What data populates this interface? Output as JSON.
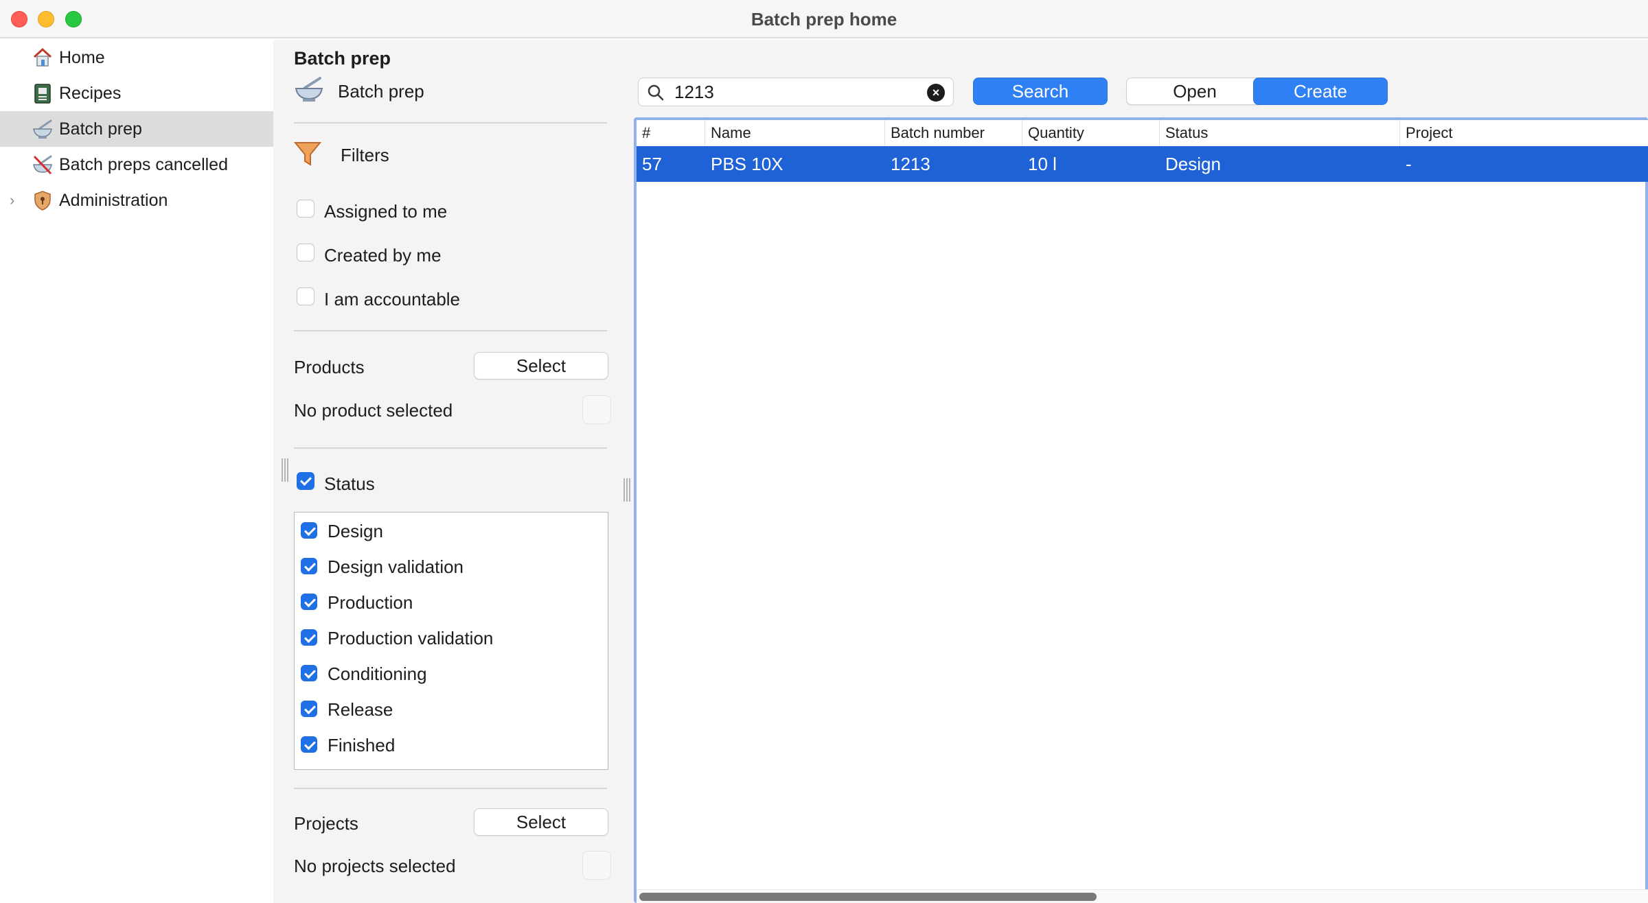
{
  "window": {
    "title": "Batch prep home"
  },
  "sidebar": {
    "items": [
      {
        "label": "Home",
        "icon": "home-icon"
      },
      {
        "label": "Recipes",
        "icon": "recipe-book-icon"
      },
      {
        "label": "Batch prep",
        "icon": "mortar-icon",
        "selected": true
      },
      {
        "label": "Batch preps cancelled",
        "icon": "cancelled-mortar-icon"
      },
      {
        "label": "Administration",
        "icon": "shield-icon",
        "expandable": true
      }
    ]
  },
  "filters": {
    "heading": "Batch prep",
    "type_label": "Batch prep",
    "filters_label": "Filters",
    "checks": [
      {
        "label": "Assigned to me",
        "checked": false
      },
      {
        "label": "Created by me",
        "checked": false
      },
      {
        "label": "I am accountable",
        "checked": false
      }
    ],
    "products": {
      "label": "Products",
      "button": "Select",
      "empty": "No product selected"
    },
    "status": {
      "label": "Status",
      "checked": true,
      "items": [
        {
          "label": "Design",
          "checked": true
        },
        {
          "label": "Design validation",
          "checked": true
        },
        {
          "label": "Production",
          "checked": true
        },
        {
          "label": "Production validation",
          "checked": true
        },
        {
          "label": "Conditioning",
          "checked": true
        },
        {
          "label": "Release",
          "checked": true
        },
        {
          "label": "Finished",
          "checked": true
        }
      ]
    },
    "projects": {
      "label": "Projects",
      "button": "Select",
      "empty": "No projects selected"
    }
  },
  "toolbar": {
    "search_value": "1213",
    "search_button": "Search",
    "open_button": "Open",
    "create_button": "Create"
  },
  "table": {
    "columns": [
      "#",
      "Name",
      "Batch number",
      "Quantity",
      "Status",
      "Project"
    ],
    "rows": [
      {
        "cells": [
          "57",
          "PBS 10X",
          "1213",
          "10 l",
          "Design",
          "-"
        ],
        "selected": true
      }
    ]
  },
  "colors": {
    "accent": "#2f80f5",
    "selection": "#1f62d6",
    "sidebar_selected": "#dcdcdc"
  }
}
